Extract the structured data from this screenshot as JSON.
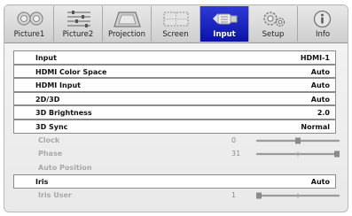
{
  "tabs": [
    {
      "label": "Picture1",
      "icon": "picture1-icon"
    },
    {
      "label": "Picture2",
      "icon": "picture2-icon"
    },
    {
      "label": "Projection",
      "icon": "projection-icon"
    },
    {
      "label": "Screen",
      "icon": "screen-icon"
    },
    {
      "label": "Input",
      "icon": "input-icon",
      "active": true
    },
    {
      "label": "Setup",
      "icon": "setup-icon"
    },
    {
      "label": "Info",
      "icon": "info-icon"
    }
  ],
  "menu": {
    "input": {
      "label": "Input",
      "value": "HDMI-1"
    },
    "hdmi_color_space": {
      "label": "HDMI Color Space",
      "value": "Auto"
    },
    "hdmi_input": {
      "label": "HDMI Input",
      "value": "Auto"
    },
    "mode_2d3d": {
      "label": "2D/3D",
      "value": "Auto"
    },
    "brightness_3d": {
      "label": "3D Brightness",
      "value": "2.0"
    },
    "sync_3d": {
      "label": "3D Sync",
      "value": "Normal"
    },
    "clock": {
      "label": "Clock",
      "value": "0",
      "level": 0.5
    },
    "phase": {
      "label": "Phase",
      "value": "31",
      "level": 1.0
    },
    "auto_position": {
      "label": "Auto Position"
    },
    "iris": {
      "label": "Iris",
      "value": "Auto"
    },
    "iris_user": {
      "label": "Iris User",
      "value": "1",
      "level": 0.0
    }
  },
  "colors": {
    "active_tab": "#0a12a8",
    "disabled_text": "#a8a8a8"
  }
}
